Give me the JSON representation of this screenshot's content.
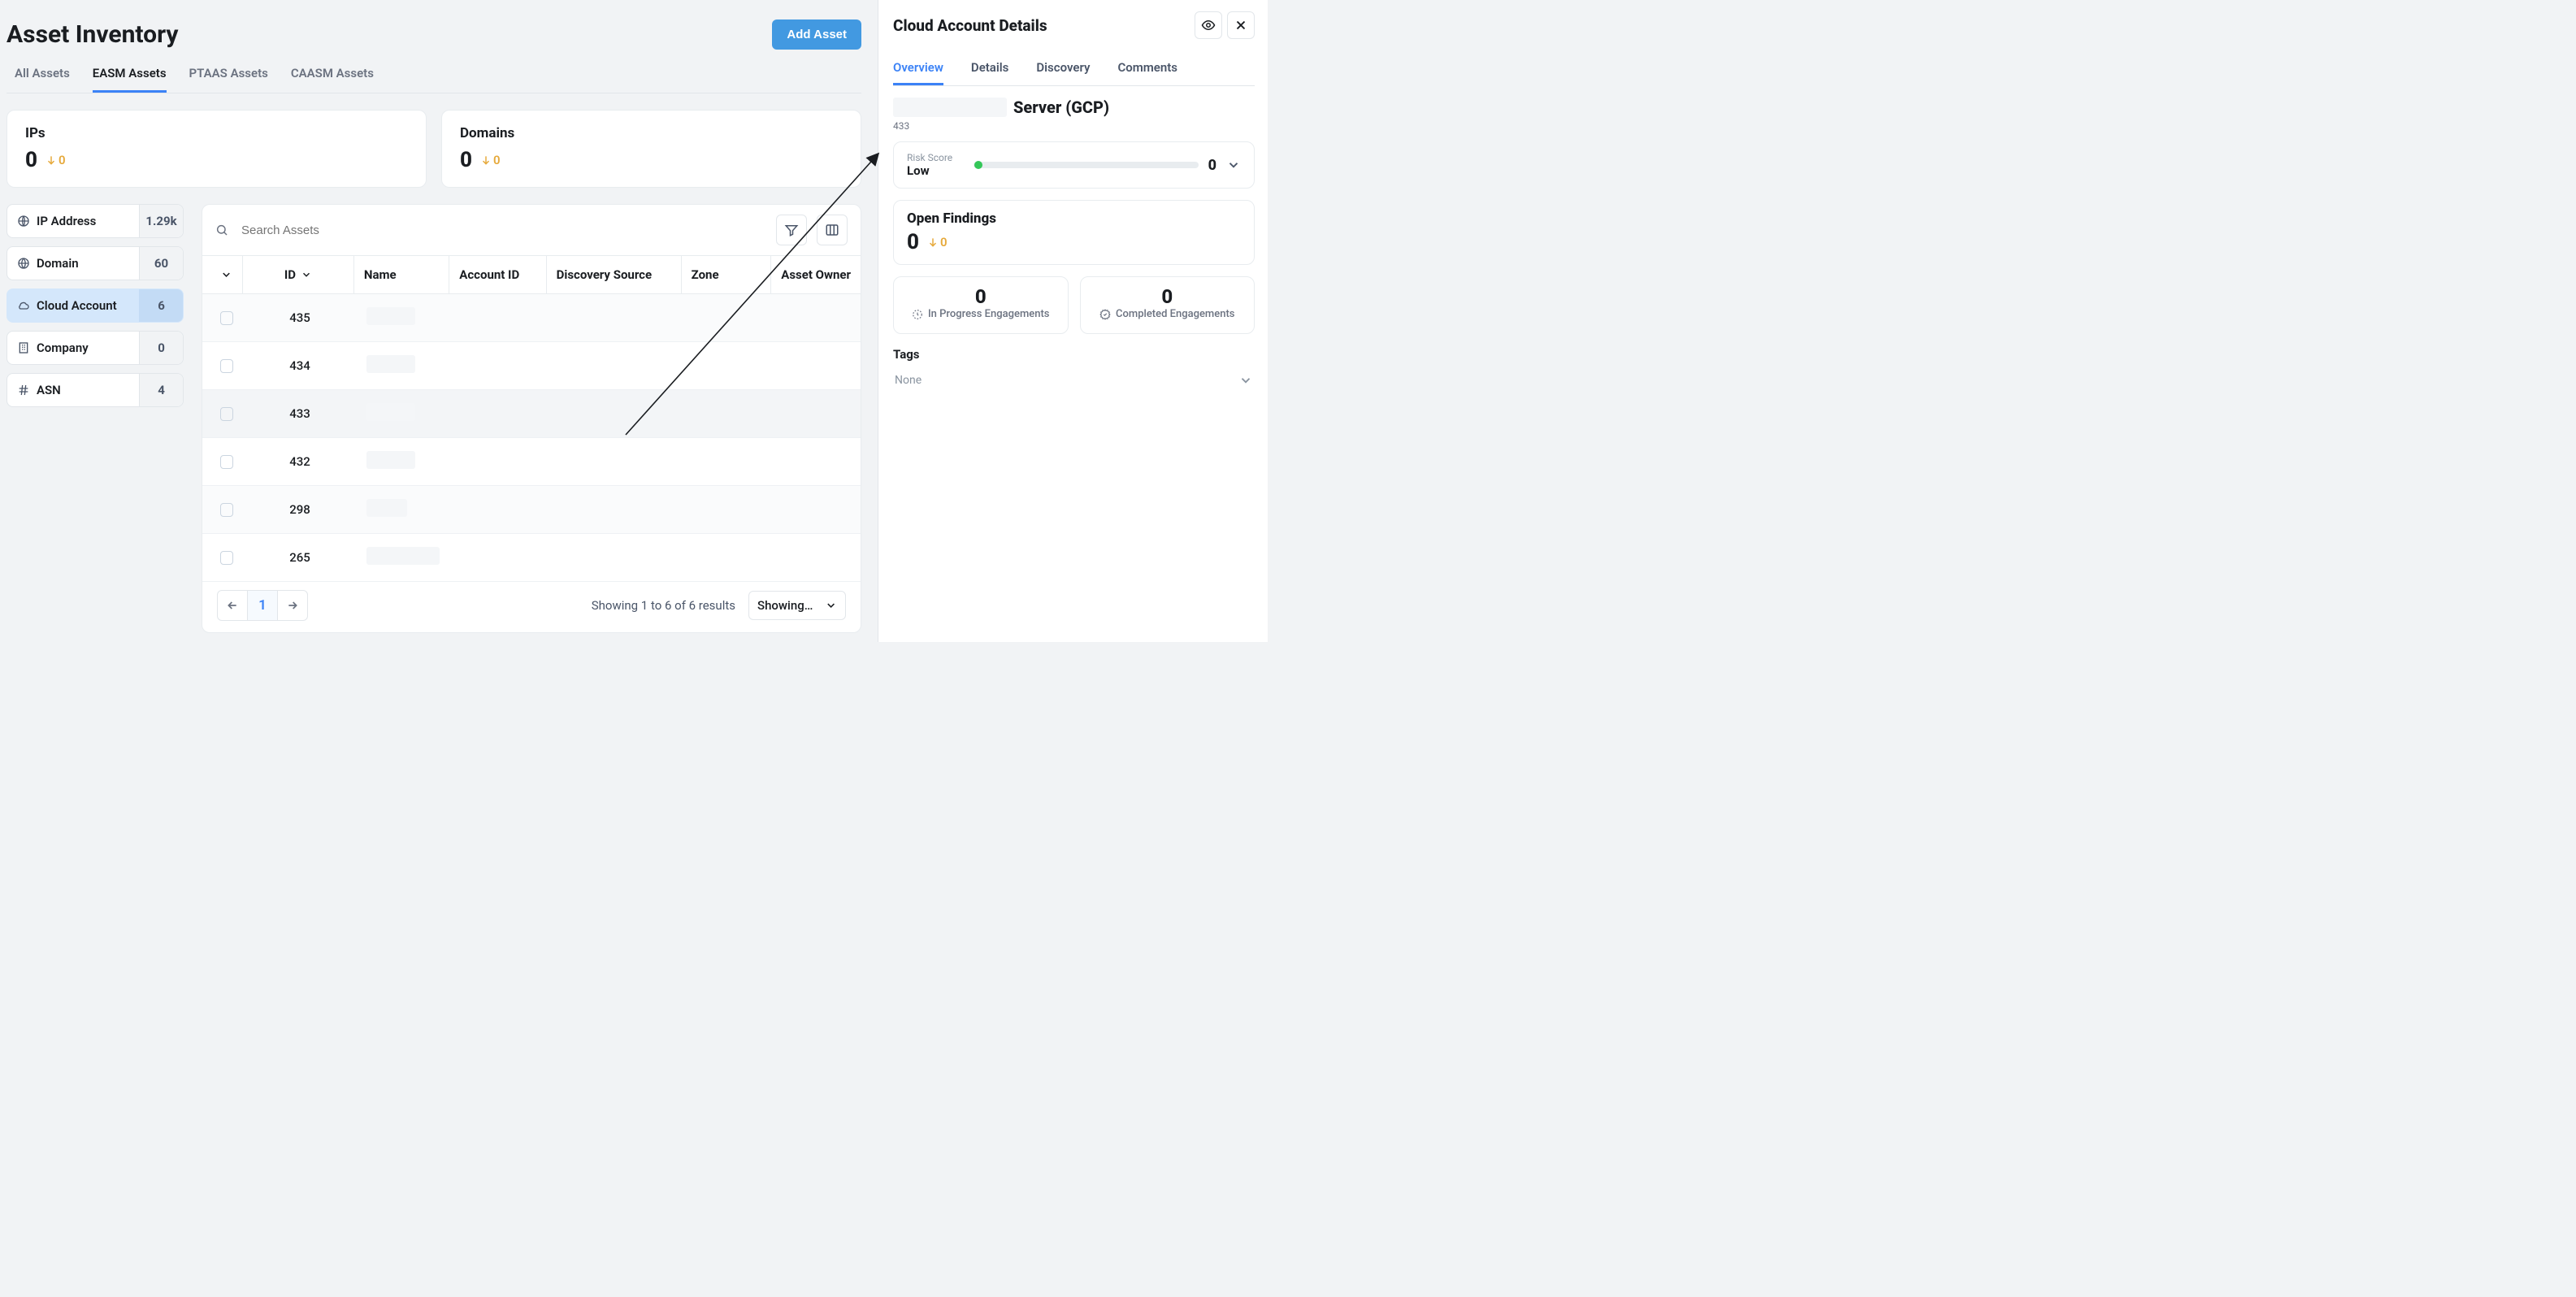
{
  "header": {
    "title": "Asset Inventory",
    "add_button": "Add Asset"
  },
  "tabs": [
    "All Assets",
    "EASM Assets",
    "PTAAS Assets",
    "CAASM Assets"
  ],
  "active_tab": 1,
  "summary_cards": [
    {
      "title": "IPs",
      "value": "0",
      "trend": "0"
    },
    {
      "title": "Domains",
      "value": "0",
      "trend": "0"
    }
  ],
  "filters": [
    {
      "label": "IP Address",
      "count": "1.29k",
      "icon": "globe"
    },
    {
      "label": "Domain",
      "count": "60",
      "icon": "world"
    },
    {
      "label": "Cloud Account",
      "count": "6",
      "icon": "cloud",
      "active": true
    },
    {
      "label": "Company",
      "count": "0",
      "icon": "building"
    },
    {
      "label": "ASN",
      "count": "4",
      "icon": "hash"
    }
  ],
  "search": {
    "placeholder": "Search Assets"
  },
  "columns": [
    "ID",
    "Name",
    "Account ID",
    "Discovery Source",
    "Zone",
    "Asset Owner"
  ],
  "rows": [
    {
      "id": "435"
    },
    {
      "id": "434"
    },
    {
      "id": "433",
      "selected": true
    },
    {
      "id": "432"
    },
    {
      "id": "298"
    },
    {
      "id": "265"
    }
  ],
  "pagination": {
    "current": "1",
    "summary": "Showing 1 to 6 of 6 results",
    "page_size_label": "Showing …"
  },
  "panel": {
    "title": "Cloud Account Details",
    "tabs": [
      "Overview",
      "Details",
      "Discovery",
      "Comments"
    ],
    "active_tab": 0,
    "name_suffix": "Server (GCP)",
    "asset_id": "433",
    "risk": {
      "label": "Risk Score",
      "level": "Low",
      "score": "0"
    },
    "open_findings": {
      "title": "Open Findings",
      "value": "0",
      "trend": "0"
    },
    "engagements": [
      {
        "count": "0",
        "label": "In Progress Engagements"
      },
      {
        "count": "0",
        "label": "Completed Engagements"
      }
    ],
    "tags": {
      "title": "Tags",
      "value": "None"
    }
  }
}
